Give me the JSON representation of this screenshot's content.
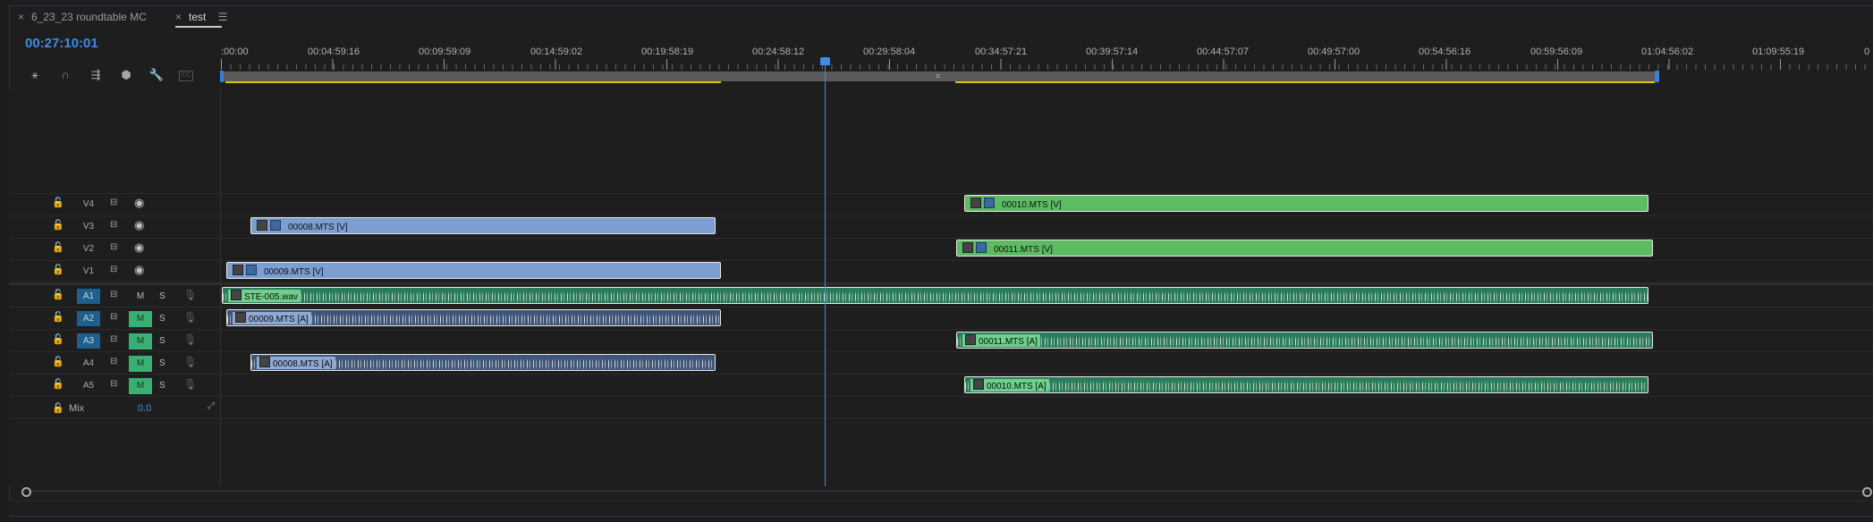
{
  "tabs": [
    {
      "label": "6_23_23 roundtable MC",
      "close": "×"
    },
    {
      "label": "test",
      "close": "×",
      "menu": "☰"
    }
  ],
  "timecode": "00:27:10:01",
  "ruler": {
    "labels": [
      ":00:00",
      "00:04:59:16",
      "00:09:59:09",
      "00:14:59:02",
      "00:19:58:19",
      "00:24:58:12",
      "00:29:58:04",
      "00:34:57:21",
      "00:39:57:14",
      "00:44:57:07",
      "00:49:57:00",
      "00:54:56:16",
      "00:59:56:09",
      "01:04:56:02",
      "01:09:55:19",
      "0"
    ]
  },
  "tools": [
    "snap-icon",
    "linked-selection-icon",
    "add-marker-edit-icon",
    "marker-icon",
    "wrench-icon",
    "captions-icon"
  ],
  "video_tracks": [
    {
      "name": "V4"
    },
    {
      "name": "V3"
    },
    {
      "name": "V2"
    },
    {
      "name": "V1"
    }
  ],
  "audio_tracks": [
    {
      "name": "A1",
      "m": "M",
      "s": "S",
      "muted": false
    },
    {
      "name": "A2",
      "m": "M",
      "s": "S",
      "muted": true
    },
    {
      "name": "A3",
      "m": "M",
      "s": "S",
      "muted": true
    },
    {
      "name": "A4",
      "m": "M",
      "s": "S",
      "muted": true
    },
    {
      "name": "A5",
      "m": "M",
      "s": "S",
      "muted": true
    }
  ],
  "mix": {
    "label": "Mix",
    "value": "0.0"
  },
  "clips": {
    "v4": "00010.MTS [V]",
    "v3": "00008.MTS [V]",
    "v2": "00011.MTS [V]",
    "v1": "00009.MTS [V]",
    "a1": "STE-005.wav",
    "a2": "00009.MTS [A]",
    "a3": "00011.MTS [A]",
    "a4": "00008.MTS [A]",
    "a5": "00010.MTS [A]"
  },
  "colors": {
    "accent": "#3d8de6",
    "video_blue": "#7c9ed0",
    "video_green": "#5dbb63",
    "audio_green": "#2a7b59",
    "audio_blue": "#3e5578",
    "mute_on": "#38b074",
    "in_out": "#e0c000"
  }
}
